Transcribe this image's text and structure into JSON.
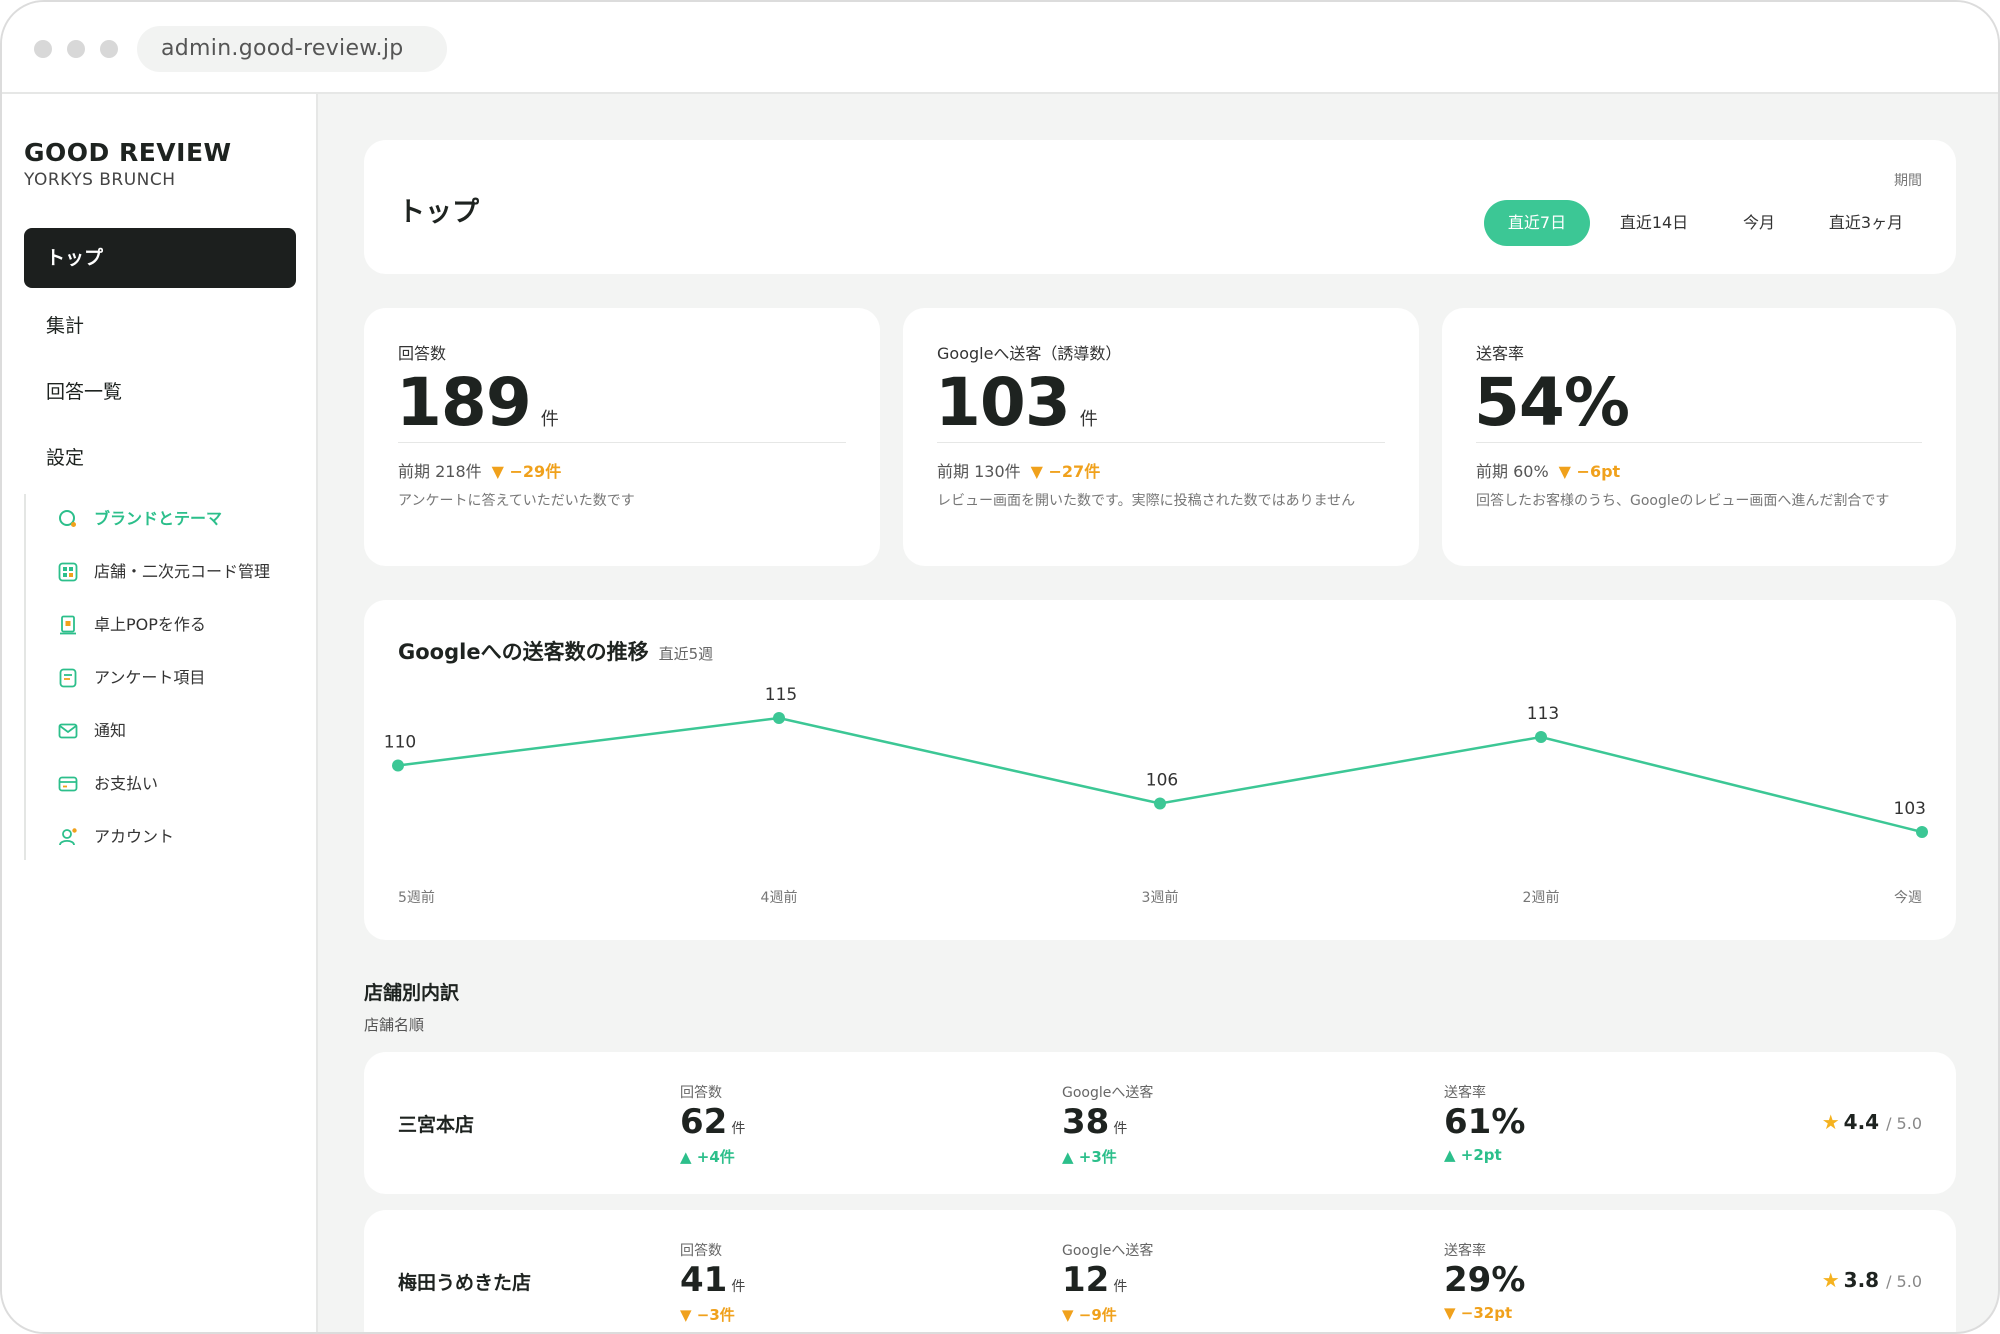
{
  "browser": {
    "url": "admin.good-review.jp"
  },
  "sidebar": {
    "brand": "GOOD REVIEW",
    "brand_sub": "YORKYS BRUNCH",
    "nav": [
      {
        "label": "トップ"
      },
      {
        "label": "集計"
      },
      {
        "label": "回答一覧"
      },
      {
        "label": "設定"
      }
    ],
    "settings": [
      {
        "label": "ブランドとテーマ",
        "icon": "palette-icon"
      },
      {
        "label": "店舗・二次元コード管理",
        "icon": "qr-code-icon"
      },
      {
        "label": "卓上POPを作る",
        "icon": "pop-stand-icon"
      },
      {
        "label": "アンケート項目",
        "icon": "survey-icon"
      },
      {
        "label": "通知",
        "icon": "mail-icon"
      },
      {
        "label": "お支払い",
        "icon": "credit-card-icon"
      },
      {
        "label": "アカウント",
        "icon": "user-icon"
      }
    ]
  },
  "header": {
    "title": "トップ",
    "period_label": "期間",
    "periods": [
      "直近7日",
      "直近14日",
      "今月",
      "直近3ヶ月"
    ],
    "active_period": "直近7日"
  },
  "stats": [
    {
      "label": "回答数",
      "value": "189",
      "unit": "件",
      "prev": "前期 218件",
      "delta": "▼ −29件",
      "desc": "アンケートに答えていただいた数です"
    },
    {
      "label": "Googleへ送客（誘導数）",
      "value": "103",
      "unit": "件",
      "prev": "前期 130件",
      "delta": "▼ −27件",
      "desc": "レビュー画面を開いた数です。実際に投稿された数ではありません"
    },
    {
      "label": "送客率",
      "value": "54%",
      "unit": "",
      "prev": "前期 60%",
      "delta": "▼ −6pt",
      "desc": "回答したお客様のうち、Googleのレビュー画面へ進んだ割合です"
    }
  ],
  "chart": {
    "title": "Googleへの送客数の推移",
    "subtitle": "直近5週"
  },
  "chart_data": {
    "type": "line",
    "categories": [
      "5週前",
      "4週前",
      "3週前",
      "2週前",
      "今週"
    ],
    "values": [
      110,
      115,
      106,
      113,
      103
    ],
    "title": "Googleへの送客数の推移",
    "xlabel": "",
    "ylabel": "",
    "color": "#3cc795",
    "grid": false
  },
  "stores_section": {
    "title": "店舗別内訳",
    "sort": "店舗名順",
    "labels": {
      "answers": "回答数",
      "google": "Googleへ送客",
      "rate": "送客率",
      "rating_max": "/ 5.0"
    },
    "stores": [
      {
        "name": "三宮本店",
        "answers": "62",
        "answers_unit": "件",
        "answers_delta": "▲ +4件",
        "answers_dir": "up",
        "google": "38",
        "google_unit": "件",
        "google_delta": "▲ +3件",
        "google_dir": "up",
        "rate": "61%",
        "rate_delta": "▲ +2pt",
        "rate_dir": "up",
        "rating": "4.4"
      },
      {
        "name": "梅田うめきた店",
        "answers": "41",
        "answers_unit": "件",
        "answers_delta": "▼ −3件",
        "answers_dir": "down",
        "google": "12",
        "google_unit": "件",
        "google_delta": "▼ −9件",
        "google_dir": "down",
        "rate": "29%",
        "rate_delta": "▼ −32pt",
        "rate_dir": "down",
        "rating": "3.8"
      }
    ]
  },
  "colors": {
    "accent": "#3cc795",
    "warning": "#f0a11c",
    "dark": "#1c1f1e"
  }
}
